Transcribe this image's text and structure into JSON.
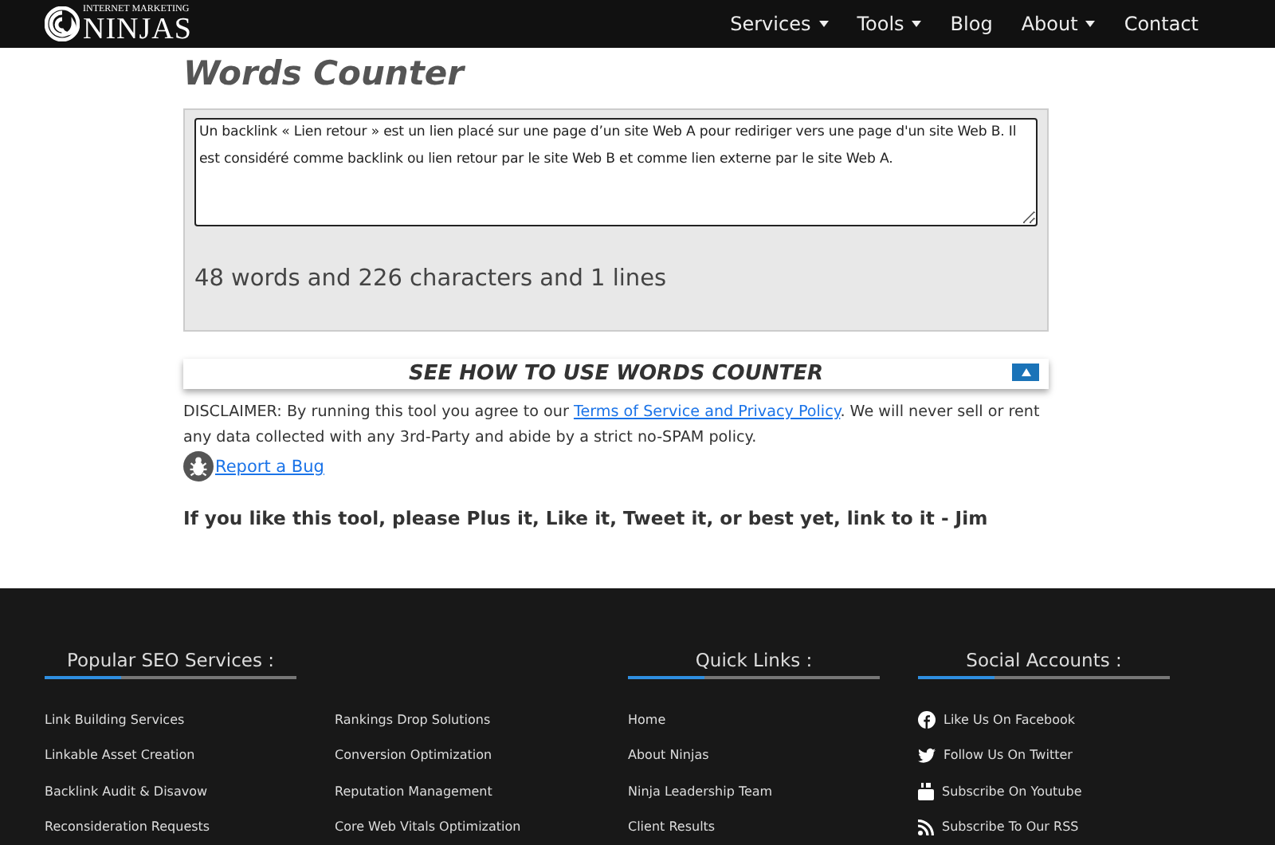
{
  "header": {
    "logo_small": "INTERNET MARKETING",
    "logo_big": "NINJAS",
    "nav": [
      {
        "label": "Services",
        "dropdown": true
      },
      {
        "label": "Tools",
        "dropdown": true
      },
      {
        "label": "Blog",
        "dropdown": false
      },
      {
        "label": "About",
        "dropdown": true
      },
      {
        "label": "Contact",
        "dropdown": false
      }
    ]
  },
  "title": "Words Counter",
  "tool": {
    "value": "Un backlink « Lien retour » est un lien placé sur une page d’un site Web A pour rediriger vers une page d'un site Web B. Il est considéré comme backlink ou lien retour par le site Web B et comme lien externe par le site Web A.",
    "result": "48 words and 226 characters and 1 lines"
  },
  "howto": {
    "label": "SEE HOW TO USE WORDS COUNTER",
    "expanded": false
  },
  "disclaimer": {
    "before": "DISCLAIMER: By running this tool you agree to our ",
    "link": "Terms of Service and Privacy Policy",
    "after": ". We will never sell or rent any data collected with any 3rd-Party and abide by a strict no-SPAM policy."
  },
  "report_bug": "Report a Bug",
  "plug": "If you like this tool, please Plus it, Like it, Tweet it, or best yet, link to it - Jim",
  "footer": {
    "columns": [
      {
        "heading": "Popular SEO Services :",
        "link_columns": [
          [
            "Link Building Services",
            "Linkable Asset Creation",
            "Backlink Audit & Disavow",
            "Reconsideration Requests"
          ],
          [
            "Rankings Drop Solutions",
            "Conversion Optimization",
            "Reputation Management",
            "Core Web Vitals Optimization"
          ]
        ]
      },
      {
        "heading": "Quick Links :",
        "link_columns": [
          [
            "Home",
            "About Ninjas",
            "Ninja Leadership Team",
            "Client Results"
          ]
        ]
      }
    ],
    "social": {
      "heading": "Social Accounts :",
      "links": [
        {
          "kind": "facebook",
          "label": "Like Us On Facebook"
        },
        {
          "kind": "twitter",
          "label": "Follow Us On Twitter"
        },
        {
          "kind": "youtube",
          "label": "Subscribe On Youtube"
        },
        {
          "kind": "rss",
          "label": "Subscribe To Our RSS"
        }
      ]
    }
  }
}
